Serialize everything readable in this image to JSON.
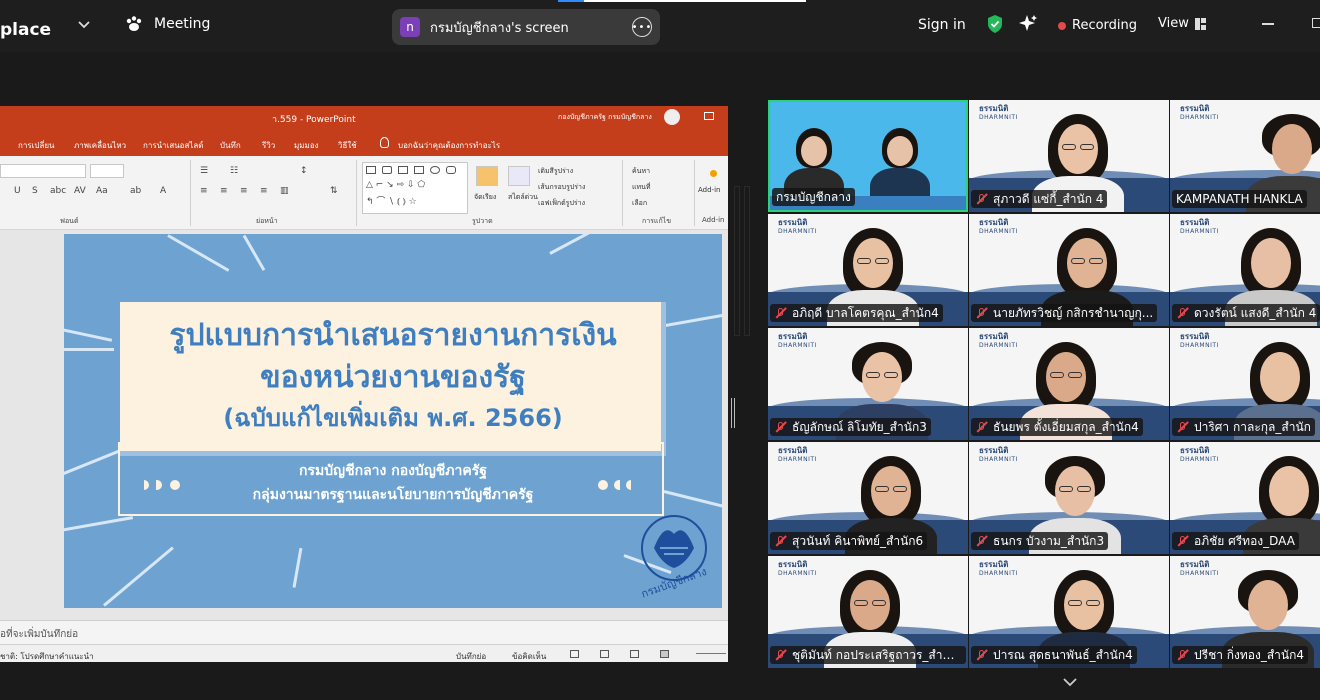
{
  "topbar": {
    "app_name": "place",
    "meeting_label": "Meeting",
    "share_avatar_letter": "n",
    "share_title": "กรมบัญชีกลาง's screen",
    "sign_in": "Sign in",
    "recording_label": "Recording",
    "view_label": "View",
    "icons": [
      "chevron-down-icon",
      "paw-icon",
      "more-icon",
      "shield-check-icon",
      "sparkle-icon",
      "record-dot-icon",
      "grid-view-icon",
      "minimize-icon",
      "maximize-icon"
    ]
  },
  "powerpoint": {
    "title": "า.559 - PowerPoint",
    "account_name": "กองบัญชีภาครัฐ กรมบัญชีกลาง",
    "tabs": [
      "การเปลี่ยน",
      "ภาพเคลื่อนไหว",
      "การนำเสนอสไลด์",
      "บันทึก",
      "รีวิว",
      "มุมมอง",
      "วิธีใช้",
      "บอกฉันว่าคุณต้องการทำอะไร"
    ],
    "ribbon_groups": [
      "ฟอนต์",
      "ย่อหน้า",
      "รูปวาด",
      "การแก้ไข",
      "Add-in"
    ],
    "ribbon_labels": {
      "arrange": "จัดเรียง",
      "quick_styles": "สไตล์ด่วน",
      "shape_fill": "เติมสีรูปร่าง",
      "shape_outline": "เส้นกรอบรูปร่าง",
      "shape_effects": "เอฟเฟ็กต์รูปร่าง",
      "find": "ค้นหา",
      "replace": "แทนที่",
      "select": "เลือก",
      "addins": "Add-in"
    },
    "slide": {
      "title_line1": "รูปแบบการนำเสนอรายงานการเงิน",
      "title_line2": "ของหน่วยงานของรัฐ",
      "title_line3": "(ฉบับแก้ไขเพิ่มเติม พ.ศ. 2566)",
      "sub_line1": "กรมบัญชีกลาง กองบัญชีภาครัฐ",
      "sub_line2": "กลุ่มงานมาตรฐานและนโยบายการบัญชีภาครัฐ",
      "seal_text": "กรมบัญชีกลาง"
    },
    "notes_placeholder": "อที่จะเพิ่มบันทึกย่อ",
    "status_left": "ชาติ: โปรดศึกษาคำแนะนำ",
    "status_notes": "บันทึกย่อ",
    "status_comments": "ข้อคิดเห็น"
  },
  "gallery": {
    "tile_logo": "ธรรมนิติ",
    "tile_logo_sub": "DHARMNITI",
    "participants": [
      {
        "name": "กรมบัญชีกลาง",
        "muted": false
      },
      {
        "name": "สุภาวดี แซ่กี้_สำนัก 4",
        "muted": true
      },
      {
        "name": "KAMPANATH HANKLA",
        "muted": false
      },
      {
        "name": "อภิฤดี บาลโคตรคุณ_สำนัก4",
        "muted": true
      },
      {
        "name": "นายภัทรวิชญ์ กสิกรชำนาญกุ...",
        "muted": true
      },
      {
        "name": "ดวงรัตน์ แสงดี_สำนัก 4",
        "muted": true
      },
      {
        "name": "ธัญลักษณ์ ลิโมทัย_สำนัก3",
        "muted": true
      },
      {
        "name": "ธันยพร ตั้งเอี่ยมสกุล_สำนัก4",
        "muted": true
      },
      {
        "name": "ปาริศา กาละกุล_สำนัก",
        "muted": true
      },
      {
        "name": "สุวนันท์ คินาพิทย์_สำนัก6",
        "muted": true
      },
      {
        "name": "ธนกร บัวงาม_สำนัก3",
        "muted": true
      },
      {
        "name": "อภิชัย ศรีทอง_DAA",
        "muted": true
      },
      {
        "name": "ชุติมันท์ กอประเสริฐถาวร_สำนั...",
        "muted": true
      },
      {
        "name": "ปารณ สุดธนาพันธ์_สำนัก4",
        "muted": true
      },
      {
        "name": "ปรีชา กิ่งทอง_สำนัก4",
        "muted": true
      }
    ]
  },
  "colors": {
    "powerpoint_accent": "#c43e1c",
    "slide_bg": "#6ea3d1",
    "active_speaker": "#2ad37a",
    "muted": "#e5484d",
    "recording": "#e5484d"
  }
}
